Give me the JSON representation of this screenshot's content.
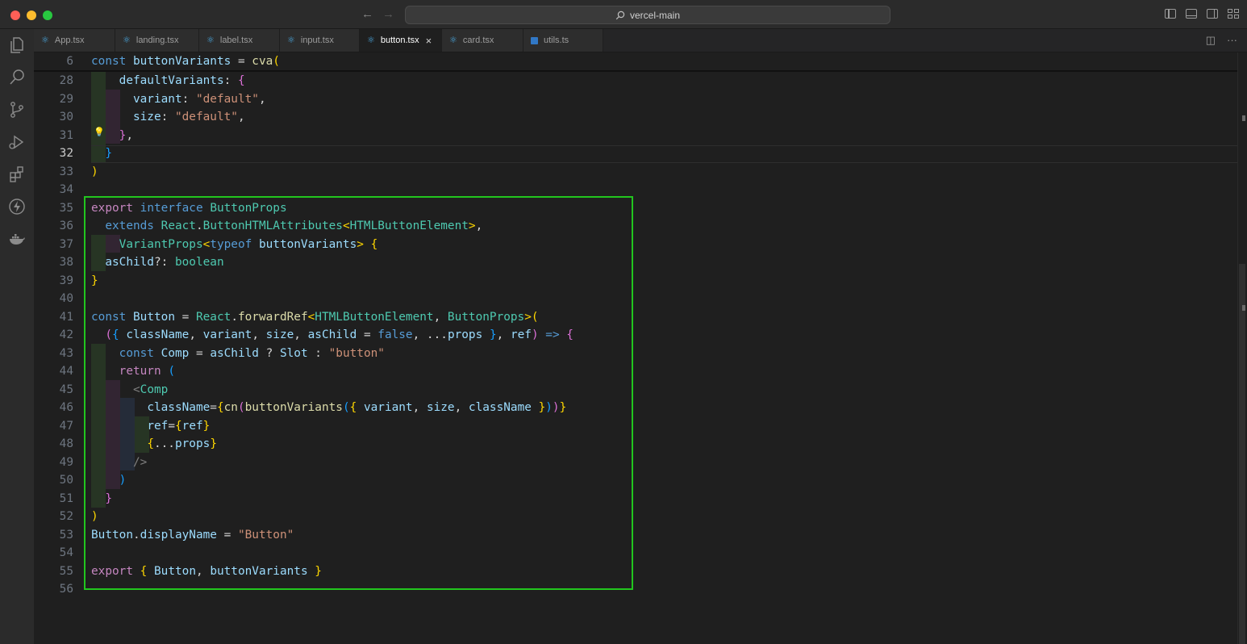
{
  "window": {
    "search_text": "vercel-main",
    "back_icon": "arrow-left-icon",
    "forward_icon": "arrow-right-icon"
  },
  "tabs": [
    {
      "label": "App.tsx",
      "icon": "react-icon",
      "active": false
    },
    {
      "label": "landing.tsx",
      "icon": "react-icon",
      "active": false
    },
    {
      "label": "label.tsx",
      "icon": "react-icon",
      "active": false
    },
    {
      "label": "input.tsx",
      "icon": "react-icon",
      "active": false
    },
    {
      "label": "button.tsx",
      "icon": "react-icon",
      "active": true
    },
    {
      "label": "card.tsx",
      "icon": "react-icon",
      "active": false
    },
    {
      "label": "utils.ts",
      "icon": "typescript-icon",
      "active": false
    }
  ],
  "activity_bar": [
    "explorer-icon",
    "search-icon",
    "source-control-icon",
    "run-debug-icon",
    "extensions-icon",
    "lightning-icon",
    "docker-icon"
  ],
  "editor": {
    "sticky_line_number": "6",
    "current_line": "32",
    "line_numbers": [
      "28",
      "29",
      "30",
      "31",
      "32",
      "33",
      "34",
      "35",
      "36",
      "37",
      "38",
      "39",
      "40",
      "41",
      "42",
      "43",
      "44",
      "45",
      "46",
      "47",
      "48",
      "49",
      "50",
      "51",
      "52",
      "53",
      "54",
      "55",
      "56"
    ],
    "colors": {
      "highlight_border": "#22c51e",
      "background": "#1f1f1f"
    }
  }
}
